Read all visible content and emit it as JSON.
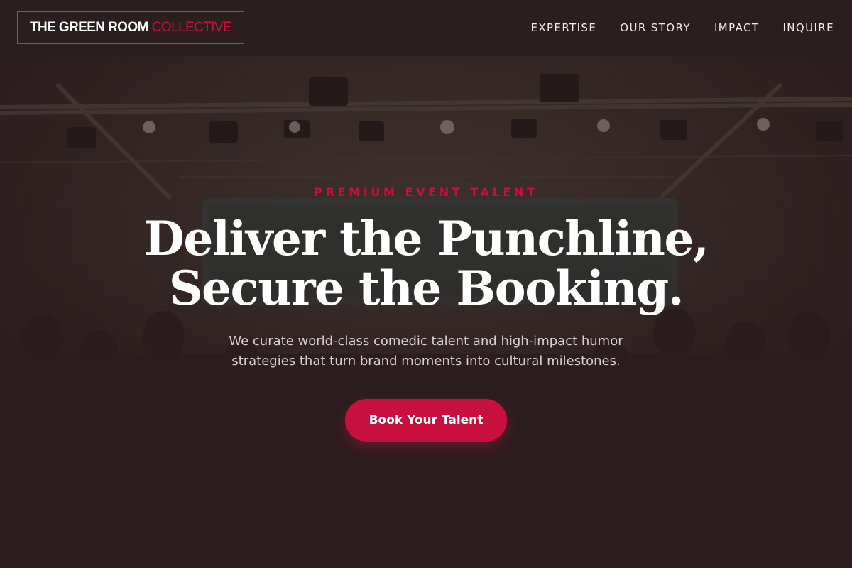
{
  "brand": {
    "name": "THE GREEN ROOM",
    "accent": "COLLECTIVE",
    "accent_color": "#c8103f"
  },
  "nav": {
    "items": [
      {
        "label": "EXPERTISE"
      },
      {
        "label": "OUR STORY"
      },
      {
        "label": "IMPACT"
      },
      {
        "label": "INQUIRE"
      }
    ]
  },
  "hero": {
    "eyebrow": "PREMIUM EVENT TALENT",
    "headline_line1": "Deliver the Punchline,",
    "headline_line2": "Secure the Booking.",
    "subtext": "We curate world-class comedic talent and high-impact humor strategies that turn brand moments into cultural milestones.",
    "cta_label": "Book Your Talent",
    "background": "dimmed photo of a large crowd under stage lighting trusses"
  },
  "colors": {
    "background": "#2b1e1f",
    "accent": "#c8103f",
    "text": "#ffffff"
  }
}
